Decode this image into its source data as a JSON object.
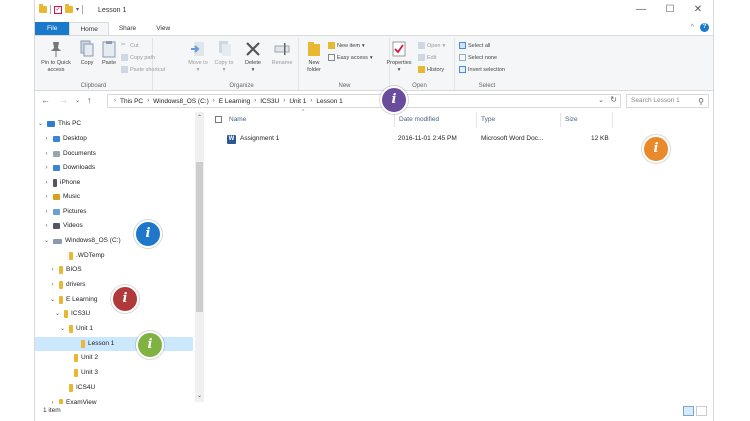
{
  "window": {
    "title": "Lesson 1",
    "controls": {
      "minimize": "—",
      "maximize": "☐",
      "close": "✕"
    }
  },
  "ribbon_tabs": [
    "File",
    "Home",
    "Share",
    "View"
  ],
  "ribbon": {
    "clipboard": {
      "label": "Clipboard",
      "pin": "Pin to Quick access",
      "copy": "Copy",
      "paste": "Paste",
      "cut": "Cut",
      "copy_path": "Copy path",
      "paste_shortcut": "Paste shortcut"
    },
    "organize": {
      "label": "Organize",
      "move_to": "Move to",
      "copy_to": "Copy to",
      "delete": "Delete",
      "rename": "Rename"
    },
    "new": {
      "label": "New",
      "new_folder": "New folder",
      "new_item": "New item",
      "easy_access": "Easy access"
    },
    "open": {
      "label": "Open",
      "properties": "Properties",
      "open": "Open",
      "edit": "Edit",
      "history": "History"
    },
    "select": {
      "label": "Select",
      "select_all": "Select all",
      "select_none": "Select none",
      "invert": "Invert selection"
    }
  },
  "address": {
    "crumbs": [
      "This PC",
      "Windows8_OS (C:)",
      "E Learning",
      "ICS3U",
      "Unit 1",
      "Lesson 1"
    ],
    "search_placeholder": "Search Lesson 1"
  },
  "nav_tree": [
    {
      "label": "This PC",
      "chev": "⌄"
    },
    {
      "label": "Desktop",
      "chev": "›"
    },
    {
      "label": "Documents",
      "chev": "›"
    },
    {
      "label": "Downloads",
      "chev": "›"
    },
    {
      "label": "iPhone",
      "chev": "›"
    },
    {
      "label": "Music",
      "chev": "›"
    },
    {
      "label": "Pictures",
      "chev": "›"
    },
    {
      "label": "Videos",
      "chev": "›"
    },
    {
      "label": "Windows8_OS (C:)",
      "chev": "⌄"
    },
    {
      "label": ".WDTemp",
      "chev": ""
    },
    {
      "label": "BIOS",
      "chev": "›"
    },
    {
      "label": "drivers",
      "chev": "›"
    },
    {
      "label": "E Learning",
      "chev": "⌄"
    },
    {
      "label": "ICS3U",
      "chev": "⌄"
    },
    {
      "label": "Unit 1",
      "chev": "⌄"
    },
    {
      "label": "Lesson 1",
      "chev": ""
    },
    {
      "label": "Unit 2",
      "chev": ""
    },
    {
      "label": "Unit 3",
      "chev": ""
    },
    {
      "label": "ICS4U",
      "chev": ""
    },
    {
      "label": "ExamView",
      "chev": "›"
    }
  ],
  "columns": {
    "name": "Name",
    "date": "Date modified",
    "type": "Type",
    "size": "Size"
  },
  "files": [
    {
      "name": "Assignment 1",
      "date": "2016-11-01 2:45 PM",
      "type": "Microsoft Word Doc...",
      "size": "12 KB"
    }
  ],
  "status": {
    "items": "1 item"
  },
  "markers": {
    "symbol": "i",
    "colors": {
      "purple": "#6a4c9c",
      "orange": "#e8892a",
      "blue": "#1f77c9",
      "red": "#b03a3a",
      "green": "#7fb241"
    }
  }
}
